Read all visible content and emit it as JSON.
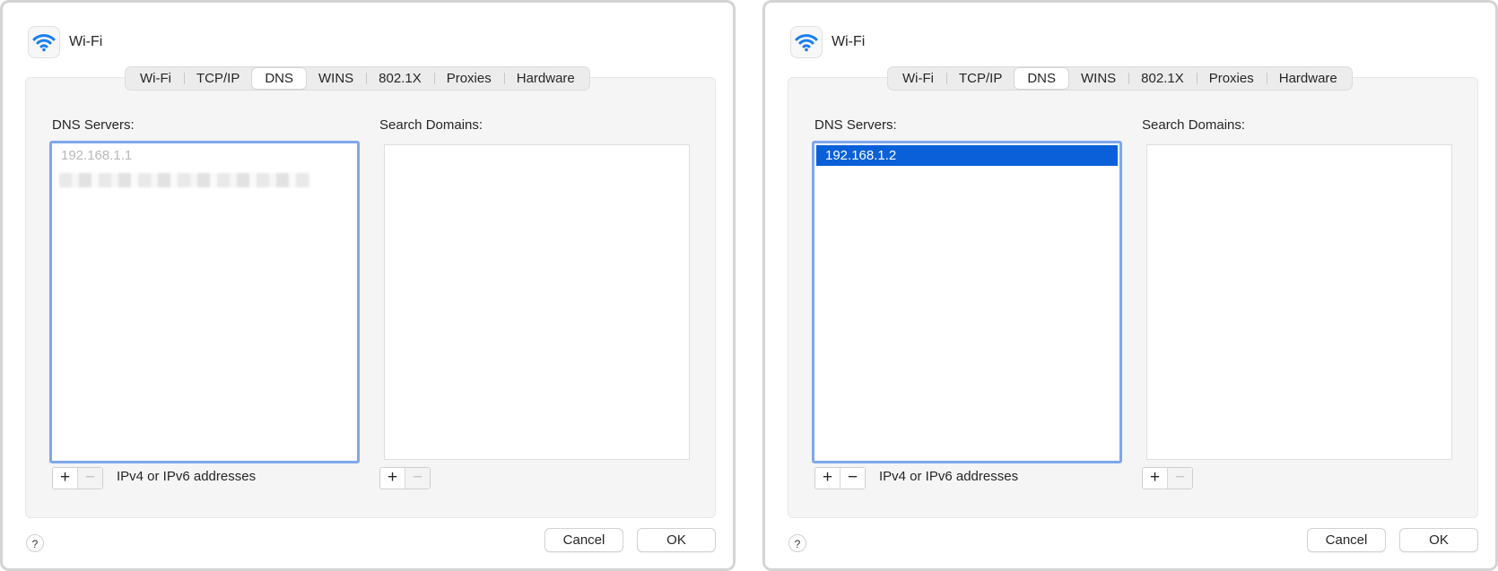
{
  "panels": [
    {
      "title": "Wi-Fi",
      "tabs": [
        "Wi-Fi",
        "TCP/IP",
        "DNS",
        "WINS",
        "802.1X",
        "Proxies",
        "Hardware"
      ],
      "active_tab": "DNS",
      "dns_label": "DNS Servers:",
      "search_label": "Search Domains:",
      "dns_entries": [
        "192.168.1.1"
      ],
      "hint": "IPv4 or IPv6 addresses",
      "help": "?",
      "cancel": "Cancel",
      "ok": "OK"
    },
    {
      "title": "Wi-Fi",
      "tabs": [
        "Wi-Fi",
        "TCP/IP",
        "DNS",
        "WINS",
        "802.1X",
        "Proxies",
        "Hardware"
      ],
      "active_tab": "DNS",
      "dns_label": "DNS Servers:",
      "search_label": "Search Domains:",
      "dns_entries": [
        "192.168.1.2"
      ],
      "hint": "IPv4 or IPv6 addresses",
      "help": "?",
      "cancel": "Cancel",
      "ok": "OK"
    }
  ],
  "controls": {
    "plus": "+",
    "minus": "−"
  },
  "colors": {
    "accent": "#0a60d8",
    "focus_ring": "#7fa7ec",
    "wifi_icon": "#1a7ef2"
  },
  "icons": {
    "title_icon": "wifi-icon"
  }
}
